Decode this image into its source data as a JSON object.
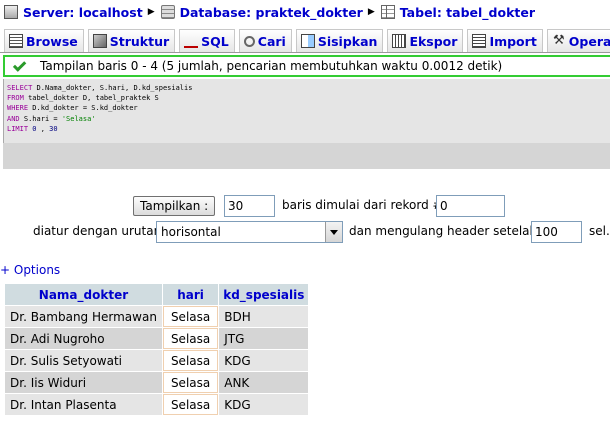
{
  "breadcrumb": {
    "server": "Server: localhost",
    "database": "Database: praktek_dokter",
    "table": "Tabel: tabel_dokter"
  },
  "tabs": [
    {
      "label": "Browse",
      "icon": "browse-icon"
    },
    {
      "label": "Struktur",
      "icon": "structure-icon"
    },
    {
      "label": "SQL",
      "icon": "sql-icon"
    },
    {
      "label": "Cari",
      "icon": "search-icon"
    },
    {
      "label": "Sisipkan",
      "icon": "insert-icon"
    },
    {
      "label": "Ekspor",
      "icon": "export-icon"
    },
    {
      "label": "Import",
      "icon": "import-icon"
    },
    {
      "label": "Operasi",
      "icon": "operations-icon"
    }
  ],
  "notice": "Tampilan baris 0 - 4 (5 jumlah, pencarian membutuhkan waktu 0.0012 detik)",
  "sql": {
    "line1_kw": "SELECT",
    "line1_rest": " D.Nama_dokter, S.hari, D.kd_spesialis",
    "line2_kw": "FROM",
    "line2_rest": " tabel_dokter D, tabel_praktek S",
    "line3_kw": "WHERE",
    "line3_rest": " D.kd_dokter = S.kd_dokter",
    "line4_kw": "AND",
    "line4_rest": " S.hari = ",
    "line4_str": "'Selasa'",
    "line5_kw": "LIMIT",
    "line5_a": "0",
    "line5_sep": " , ",
    "line5_b": "30"
  },
  "nav": {
    "show_button": "Tampilkan :",
    "rows_value": "30",
    "rows_label": "baris dimulai dari rekord #",
    "start_value": "0",
    "order_label": "diatur dengan urutan",
    "order_selected": "horisontal",
    "repeat_label": "dan mengulang header setelah",
    "repeat_value": "100",
    "cells_label": "sel."
  },
  "options_link": "+ Options",
  "table": {
    "headers": [
      "Nama_dokter",
      "hari",
      "kd_spesialis"
    ],
    "rows": [
      [
        "Dr. Bambang Hermawan",
        "Selasa",
        "BDH"
      ],
      [
        "Dr. Adi Nugroho",
        "Selasa",
        "JTG"
      ],
      [
        "Dr. Sulis Setyowati",
        "Selasa",
        "KDG"
      ],
      [
        "Dr. Iis Widuri",
        "Selasa",
        "ANK"
      ],
      [
        "Dr. Intan Plasenta",
        "Selasa",
        "KDG"
      ]
    ]
  },
  "colors": {
    "link": "#0000cc",
    "notice_border": "#33cc33",
    "header_bg": "#d0dce0",
    "row_odd": "#e5e5e5",
    "row_even": "#d5d5d5"
  }
}
